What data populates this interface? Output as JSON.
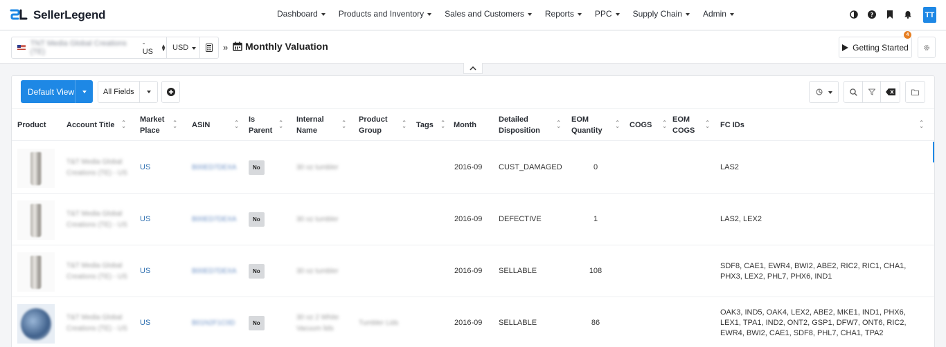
{
  "app": {
    "name": "SellerLegend",
    "user_initials": "TT",
    "colors": {
      "primary": "#1e88e5",
      "badge": "#e67e22"
    }
  },
  "nav": {
    "menu": [
      "Dashboard",
      "Products and Inventory",
      "Sales and Customers",
      "Reports",
      "PPC",
      "Supply Chain",
      "Admin"
    ],
    "icons": [
      "contrast-icon",
      "help-icon",
      "bookmark-icon",
      "bell-icon"
    ]
  },
  "subheader": {
    "account_name": "TNT Media Global Creations (TE)",
    "account_suffix": "- US",
    "currency": "USD",
    "separator": "»",
    "title": "Monthly Valuation",
    "getting_started": "Getting Started",
    "getting_started_badge": "4"
  },
  "toolbar": {
    "view_label": "Default View",
    "fields_label": "All Fields"
  },
  "table": {
    "columns": [
      "Product",
      "Account Title",
      "Market Place",
      "ASIN",
      "Is Parent",
      "Internal Name",
      "Product Group",
      "Tags",
      "Month",
      "Detailed Disposition",
      "EOM Quantity",
      "COGS",
      "EOM COGS",
      "FC IDs"
    ],
    "rows": [
      {
        "account": "T&T Media Global Creations (TE) - US",
        "marketplace": "US",
        "asin": "B00ED7DEXA",
        "is_parent": "No",
        "internal_name": "30 oz tumbler",
        "product_group": "",
        "tags": "",
        "month": "2016-09",
        "disposition": "CUST_DAMAGED",
        "eom_qty": "0",
        "cogs": "",
        "eom_cogs": "",
        "fc_ids": "LAS2"
      },
      {
        "account": "T&T Media Global Creations (TE) - US",
        "marketplace": "US",
        "asin": "B00ED7DEXA",
        "is_parent": "No",
        "internal_name": "30 oz tumbler",
        "product_group": "",
        "tags": "",
        "month": "2016-09",
        "disposition": "DEFECTIVE",
        "eom_qty": "1",
        "cogs": "",
        "eom_cogs": "",
        "fc_ids": "LAS2, LEX2"
      },
      {
        "account": "T&T Media Global Creations (TE) - US",
        "marketplace": "US",
        "asin": "B00ED7DEXA",
        "is_parent": "No",
        "internal_name": "30 oz tumbler",
        "product_group": "",
        "tags": "",
        "month": "2016-09",
        "disposition": "SELLABLE",
        "eom_qty": "108",
        "cogs": "",
        "eom_cogs": "",
        "fc_ids": "SDF8, CAE1, EWR4, BWI2, ABE2, RIC2, RIC1, CHA1, PHX3, LEX2, PHL7, PHX6, IND1"
      },
      {
        "account": "T&T Media Global Creations (TE) - US",
        "marketplace": "US",
        "asin": "B01N2F1C0D",
        "is_parent": "No",
        "internal_name": "30 oz 2 White Vacuum lids",
        "product_group": "Tumbler Lids",
        "tags": "",
        "month": "2016-09",
        "disposition": "SELLABLE",
        "eom_qty": "86",
        "cogs": "",
        "eom_cogs": "",
        "fc_ids": "OAK3, IND5, OAK4, LEX2, ABE2, MKE1, IND1, PHX6, LEX1, TPA1, IND2, ONT2, GSP1, DFW7, ONT6, RIC2, EWR4, BWI2, CAE1, SDF8, PHL7, CHA1, TPA2"
      }
    ]
  }
}
